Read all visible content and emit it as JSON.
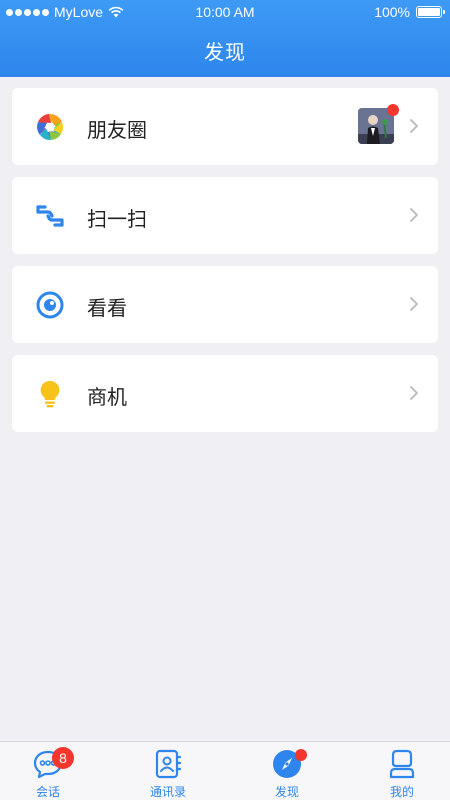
{
  "status_bar": {
    "carrier": "MyLove",
    "time": "10:00 AM",
    "battery": "100%"
  },
  "header": {
    "title": "发现"
  },
  "menu": [
    {
      "label": "朋友圈",
      "icon": "aperture-icon",
      "has_thumbnail": true,
      "has_new_dot": true
    },
    {
      "label": "扫一扫",
      "icon": "scan-icon"
    },
    {
      "label": "看看",
      "icon": "eye-icon"
    },
    {
      "label": "商机",
      "icon": "lightbulb-icon"
    }
  ],
  "tabbar": {
    "items": [
      {
        "label": "会话",
        "icon": "chat-icon",
        "badge": "8"
      },
      {
        "label": "通讯录",
        "icon": "contacts-icon"
      },
      {
        "label": "发现",
        "icon": "compass-icon",
        "active": true,
        "has_dot": true
      },
      {
        "label": "我的",
        "icon": "profile-icon"
      }
    ]
  },
  "colors": {
    "accent": "#2e86ec",
    "badge": "#f5362f",
    "background": "#efeff4"
  }
}
